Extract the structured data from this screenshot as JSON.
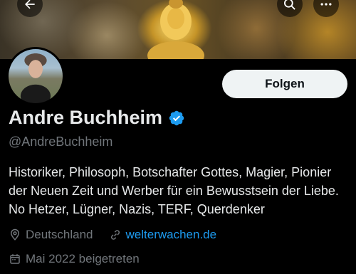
{
  "profile": {
    "display_name": "Andre Buchheim",
    "handle": "@AndreBuchheim",
    "bio": "Historiker, Philosoph, Botschafter Gottes, Magier, Pionier der Neuen Zeit und Werber für ein Bewusstsein der Liebe. No Hetzer, Lügner, Nazis, TERF, Querdenker",
    "location": "Deutschland",
    "website": "welterwachen.de",
    "joined": "Mai 2022 beigetreten",
    "verified": true
  },
  "actions": {
    "follow_label": "Folgen"
  },
  "icons": {
    "back": "back-arrow-icon",
    "search": "search-icon",
    "more": "more-options-icon",
    "verified": "verified-badge-icon",
    "location": "location-pin-icon",
    "link": "link-icon",
    "calendar": "calendar-icon"
  },
  "colors": {
    "background": "#000000",
    "text": "#e7e9ea",
    "secondary_text": "#71767b",
    "link": "#1d9bf0",
    "follow_button_bg": "#eff3f4",
    "follow_button_text": "#0f1419",
    "verified": "#1d9bf0"
  }
}
